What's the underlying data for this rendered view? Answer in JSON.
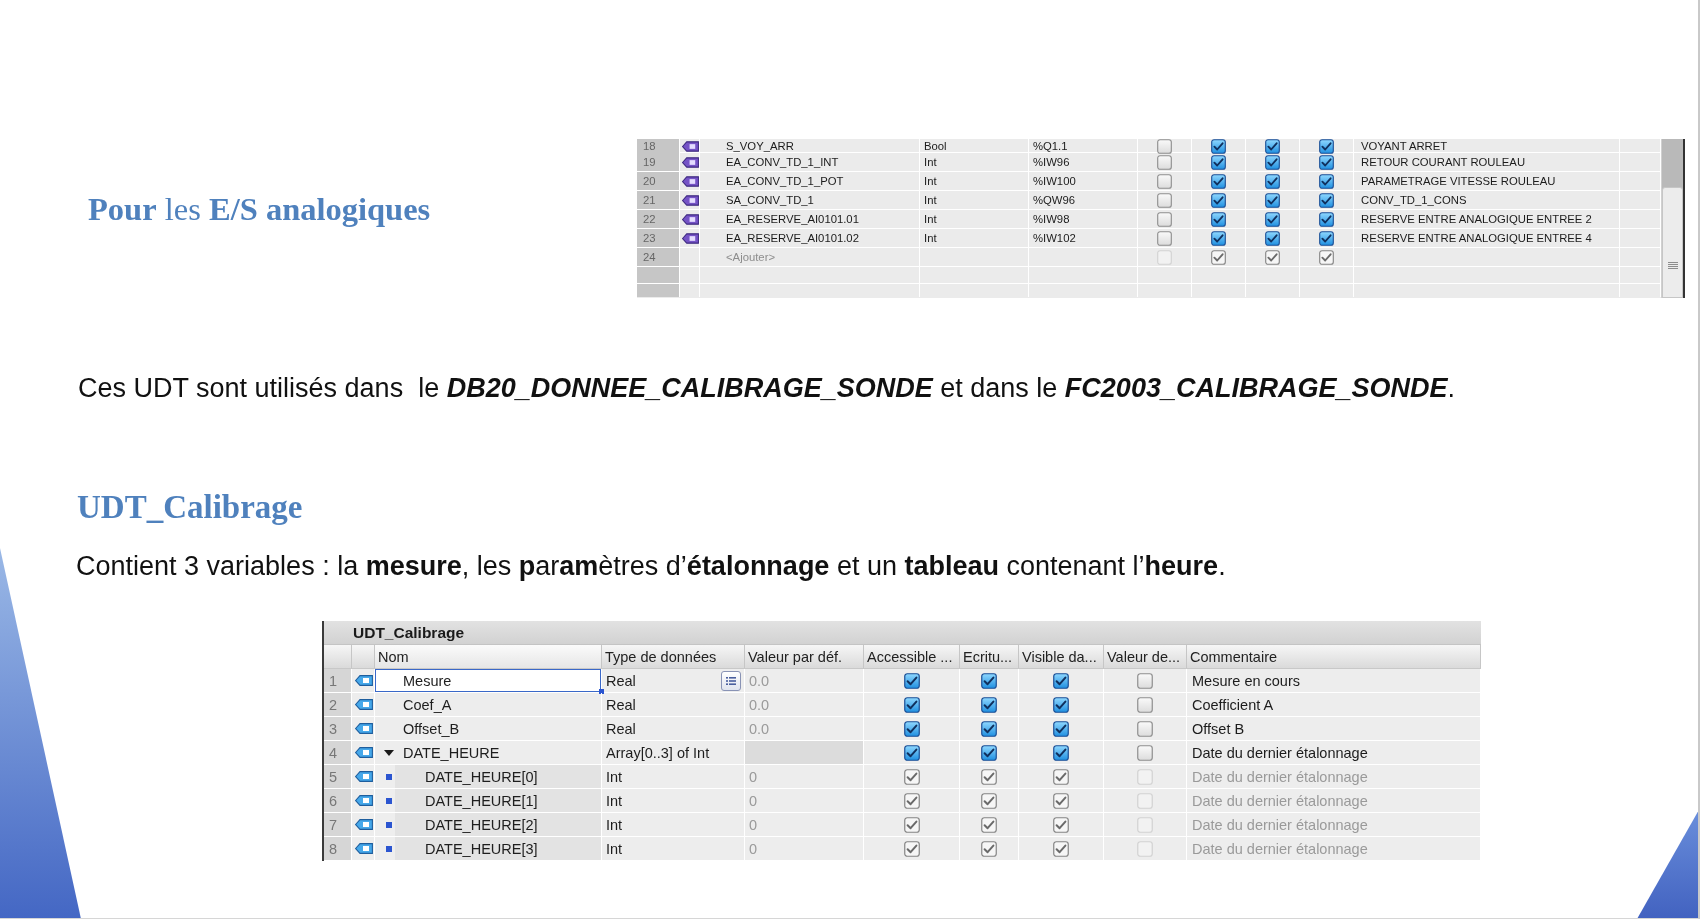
{
  "intro_heading": "**Pour** les **E/S analogiques**",
  "tag_table": {
    "rows": [
      {
        "kind": "tag",
        "number": "18",
        "name": "S_VOY_ARR",
        "data_type": "Bool",
        "address": "%Q1.1",
        "checks": [
          {
            "checked": false
          },
          {
            "checked": true
          },
          {
            "checked": true
          },
          {
            "checked": true
          }
        ],
        "comment": "VOYANT ARRET",
        "disabled": false
      },
      {
        "kind": "tag",
        "number": "19",
        "name": "EA_CONV_TD_1_INT",
        "data_type": "Int",
        "address": "%IW96",
        "checks": [
          {
            "checked": false
          },
          {
            "checked": true
          },
          {
            "checked": true
          },
          {
            "checked": true
          }
        ],
        "comment": "RETOUR COURANT ROULEAU",
        "disabled": false
      },
      {
        "kind": "tag",
        "number": "20",
        "name": "EA_CONV_TD_1_POT",
        "data_type": "Int",
        "address": "%IW100",
        "checks": [
          {
            "checked": false
          },
          {
            "checked": true
          },
          {
            "checked": true
          },
          {
            "checked": true
          }
        ],
        "comment": "PARAMETRAGE VITESSE ROULEAU",
        "disabled": false
      },
      {
        "kind": "tag",
        "number": "21",
        "name": "SA_CONV_TD_1",
        "data_type": "Int",
        "address": "%QW96",
        "checks": [
          {
            "checked": false
          },
          {
            "checked": true
          },
          {
            "checked": true
          },
          {
            "checked": true
          }
        ],
        "comment": "CONV_TD_1_CONS",
        "disabled": false
      },
      {
        "kind": "tag",
        "number": "22",
        "name": "EA_RESERVE_AI0101.01",
        "data_type": "Int",
        "address": "%IW98",
        "checks": [
          {
            "checked": false
          },
          {
            "checked": true
          },
          {
            "checked": true
          },
          {
            "checked": true
          }
        ],
        "comment": "RESERVE ENTRE ANALOGIQUE ENTREE 2",
        "disabled": false
      },
      {
        "kind": "tag",
        "number": "23",
        "name": "EA_RESERVE_AI0101.02",
        "data_type": "Int",
        "address": "%IW102",
        "checks": [
          {
            "checked": false
          },
          {
            "checked": true
          },
          {
            "checked": true
          },
          {
            "checked": true
          }
        ],
        "comment": "RESERVE ENTRE ANALOGIQUE ENTREE 4",
        "disabled": false
      },
      {
        "kind": "add",
        "number": "24",
        "name": "<Ajouter>",
        "checks": [
          {
            "checked": false
          },
          {
            "checked": true
          },
          {
            "checked": true
          },
          {
            "checked": true
          }
        ],
        "disabled": true
      }
    ]
  },
  "usage_sentence": "Ces UDT sont utilisés dans  le **DB20_DONNEE_CALIBRAGE_SONDE** et dans le **FC2003_CALIBRAGE_SONDE**.",
  "udt_heading": "UDT_Calibrage",
  "description": "Contient 3 variables : la **mesure**, les **p**ar**am**ètres d’**étalonnage** et un **tableau** contenant l’**heure**.",
  "udt_table": {
    "title": "UDT_Calibrage",
    "columns": [
      "Nom",
      "Type de données",
      "Valeur par déf.",
      "Accessible ...",
      "Ecritu...",
      "Visible da...",
      "Valeur de...",
      "Commentaire"
    ],
    "rows": [
      {
        "number": "1",
        "name": "Mesure",
        "data_type": "Real",
        "default_value": "0.0",
        "checks": [
          {
            "checked": true
          },
          {
            "checked": true
          },
          {
            "checked": true
          },
          {
            "checked": false
          }
        ],
        "comment": "Mesure en cours",
        "selected": true,
        "disabled": false
      },
      {
        "number": "2",
        "name": "Coef_A",
        "data_type": "Real",
        "default_value": "0.0",
        "checks": [
          {
            "checked": true
          },
          {
            "checked": true
          },
          {
            "checked": true
          },
          {
            "checked": false
          }
        ],
        "comment": "Coefficient A",
        "selected": false,
        "disabled": false
      },
      {
        "number": "3",
        "name": "Offset_B",
        "data_type": "Real",
        "default_value": "0.0",
        "checks": [
          {
            "checked": true
          },
          {
            "checked": true
          },
          {
            "checked": true
          },
          {
            "checked": false
          }
        ],
        "comment": "Offset B",
        "selected": false,
        "disabled": false
      },
      {
        "number": "4",
        "name": "DATE_HEURE",
        "data_type": "Array[0..3] of Int",
        "checks": [
          {
            "checked": true
          },
          {
            "checked": true
          },
          {
            "checked": true
          },
          {
            "checked": false
          }
        ],
        "comment": "Date du dernier étalonnage",
        "selected": false,
        "disabled": false,
        "expanded": true,
        "children": [
          {
            "number": "5",
            "name": "DATE_HEURE[0]",
            "data_type": "Int",
            "default_value": "0",
            "checks": [
              {
                "checked": true
              },
              {
                "checked": true
              },
              {
                "checked": true
              },
              {
                "checked": false
              }
            ],
            "comment": "Date du dernier étalonnage",
            "selected": false,
            "disabled": true
          },
          {
            "number": "6",
            "name": "DATE_HEURE[1]",
            "data_type": "Int",
            "default_value": "0",
            "checks": [
              {
                "checked": true
              },
              {
                "checked": true
              },
              {
                "checked": true
              },
              {
                "checked": false
              }
            ],
            "comment": "Date du dernier étalonnage",
            "selected": false,
            "disabled": true
          },
          {
            "number": "7",
            "name": "DATE_HEURE[2]",
            "data_type": "Int",
            "default_value": "0",
            "checks": [
              {
                "checked": true
              },
              {
                "checked": true
              },
              {
                "checked": true
              },
              {
                "checked": false
              }
            ],
            "comment": "Date du dernier étalonnage",
            "selected": false,
            "disabled": true
          },
          {
            "number": "8",
            "name": "DATE_HEURE[3]",
            "data_type": "Int",
            "default_value": "0",
            "checks": [
              {
                "checked": true
              },
              {
                "checked": true
              },
              {
                "checked": true
              },
              {
                "checked": false
              }
            ],
            "comment": "Date du dernier étalonnage",
            "selected": false,
            "disabled": true
          }
        ]
      }
    ]
  }
}
